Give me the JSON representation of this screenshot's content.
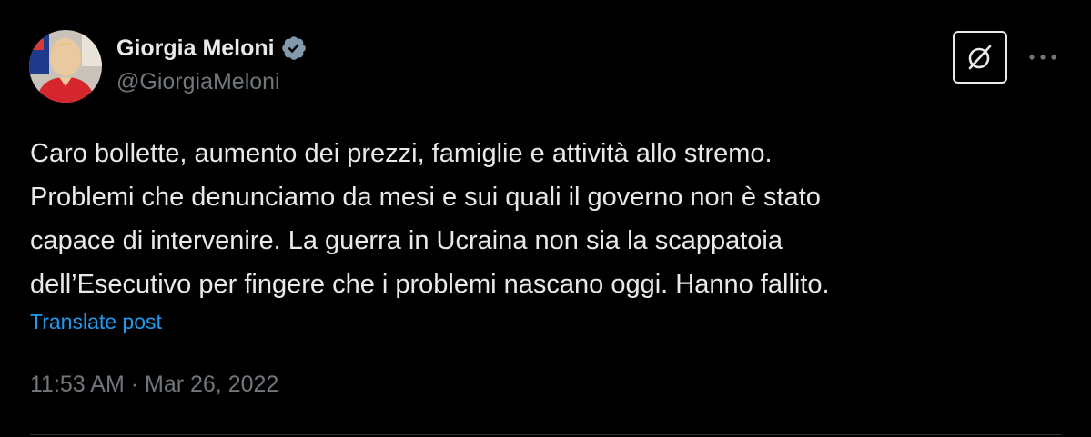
{
  "author": {
    "display_name": "Giorgia Meloni",
    "handle": "@GiorgiaMeloni",
    "verified": true
  },
  "tweet": {
    "text_lines": [
      "Caro bollette, aumento dei prezzi, famiglie e attività allo stremo.",
      "Problemi che denunciamo da mesi e sui quali il governo non è stato",
      "capace di intervenire. La guerra in Ucraina non sia la scappatoia",
      "dell’Esecutivo per fingere che i problemi nascano oggi. Hanno fallito."
    ],
    "translate_label": "Translate post",
    "timestamp": "11:53 AM · Mar 26, 2022"
  },
  "actions": {
    "grok_icon": "grok-icon",
    "more_icon": "more-icon"
  },
  "colors": {
    "background": "#000000",
    "text_primary": "#e7e9ea",
    "text_secondary": "#71767b",
    "link": "#1d9bf0",
    "verified_badge": "#829aab",
    "divider": "#2f3336"
  }
}
